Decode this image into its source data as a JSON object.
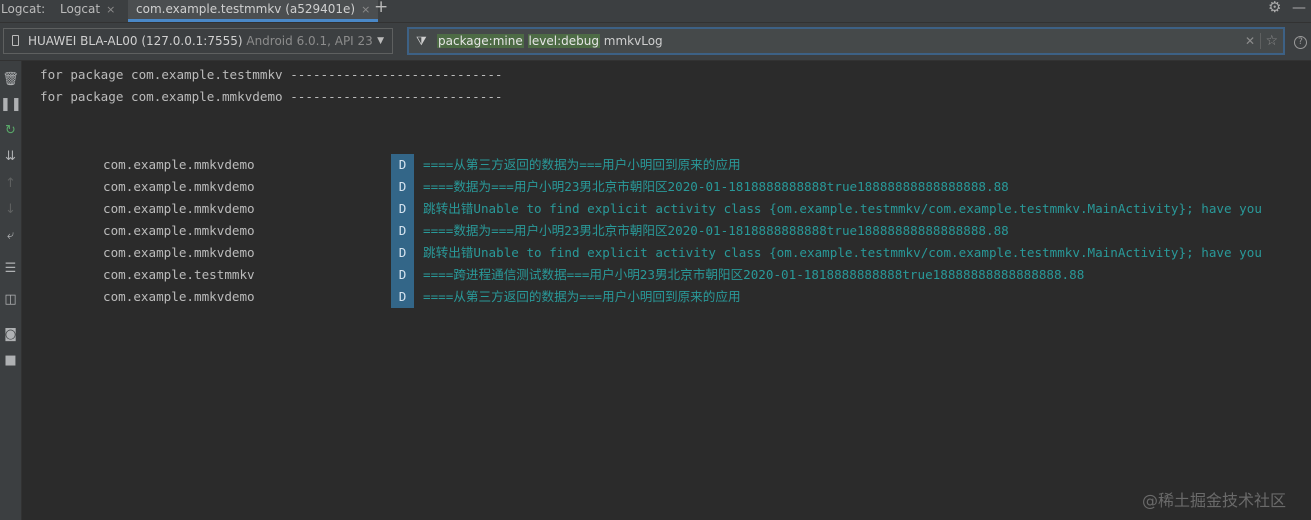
{
  "tabbar": {
    "title": "Logcat:",
    "tabs": [
      {
        "label": "Logcat"
      },
      {
        "label": "com.example.testmmkv (a529401e)"
      }
    ],
    "close_glyph": "×",
    "add_glyph": "+",
    "settings_glyph": "⚙",
    "minimize_glyph": "—"
  },
  "toolbar": {
    "device_name": "HUAWEI BLA-AL00 (127.0.0.1:7555) ",
    "device_os": "Android 6.0.1, API 23",
    "filter": {
      "token_package": "package:mine",
      "token_level": "level:debug",
      "token_text": "mmkvLog"
    },
    "help_glyph": "?"
  },
  "sidebar_icons": [
    "trash-icon",
    "pause-icon",
    "restart-icon",
    "scroll-to-end-icon",
    "up-arrow-icon",
    "down-arrow-icon",
    "soft-wrap-icon",
    "format-icon",
    "split-view-icon",
    "screenshot-icon",
    "screen-record-icon"
  ],
  "log": {
    "headers": [
      "for package com.example.testmmkv ----------------------------",
      "for package com.example.mmkvdemo ----------------------------"
    ],
    "rows": [
      {
        "package": "com.example.mmkvdemo",
        "level": "D",
        "message": "====从第三方返回的数据为===用户小明回到原来的应用"
      },
      {
        "package": "com.example.mmkvdemo",
        "level": "D",
        "message": "====数据为===用户小明23男北京市朝阳区2020-01-1818888888888true18888888888888888.88"
      },
      {
        "package": "com.example.mmkvdemo",
        "level": "D",
        "message": "跳转出错Unable to find explicit activity class {om.example.testmmkv/com.example.testmmkv.MainActivity}; have you"
      },
      {
        "package": "com.example.mmkvdemo",
        "level": "D",
        "message": "====数据为===用户小明23男北京市朝阳区2020-01-1818888888888true18888888888888888.88"
      },
      {
        "package": "com.example.mmkvdemo",
        "level": "D",
        "message": "跳转出错Unable to find explicit activity class {om.example.testmmkv/com.example.testmmkv.MainActivity}; have you"
      },
      {
        "package": "com.example.testmmkv",
        "level": "D",
        "message": "====跨进程通信测试数据===用户小明23男北京市朝阳区2020-01-1818888888888true18888888888888888.88"
      },
      {
        "package": "com.example.mmkvdemo",
        "level": "D",
        "message": "====从第三方返回的数据为===用户小明回到原来的应用"
      }
    ]
  },
  "watermark": "@稀土掘金技术社区",
  "colors": {
    "background": "#2b2b2b",
    "panel": "#3c3f41",
    "debug_level_bg": "#336688",
    "debug_text": "#299999",
    "filter_highlight": "#4d6b45",
    "active_tab_underline": "#4a88c7"
  }
}
